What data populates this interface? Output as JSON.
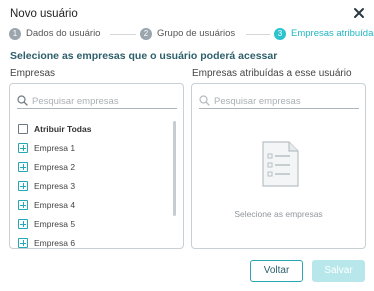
{
  "dialog": {
    "title": "Novo usuário",
    "close_icon": "close-icon"
  },
  "steps": [
    {
      "number": "1",
      "label": "Dados do usuário",
      "state": "done"
    },
    {
      "number": "2",
      "label": "Grupo de usuários",
      "state": "done"
    },
    {
      "number": "3",
      "label": "Empresas atribuídas",
      "state": "active"
    }
  ],
  "subtitle": "Selecione as empresas que o usuário poderá acessar",
  "left_panel": {
    "title": "Empresas",
    "search_placeholder": "Pesquisar empresas",
    "select_all_label": "Atribuir Todas",
    "items": [
      "Empresa 1",
      "Empresa 2",
      "Empresa 3",
      "Empresa 4",
      "Empresa 5",
      "Empresa 6"
    ]
  },
  "right_panel": {
    "title": "Empresas atribuídas a esse usuário",
    "search_placeholder": "Pesquisar empresas",
    "empty_text": "Selecione as empresas",
    "empty_icon": "document-list-icon"
  },
  "buttons": {
    "back_label": "Voltar",
    "save_label": "Salvar"
  },
  "colors": {
    "accent": "#2cc3cf",
    "step_inactive": "#9aa5ad",
    "subtitle": "#2d5f6b",
    "save_disabled": "#b8e7eb"
  }
}
